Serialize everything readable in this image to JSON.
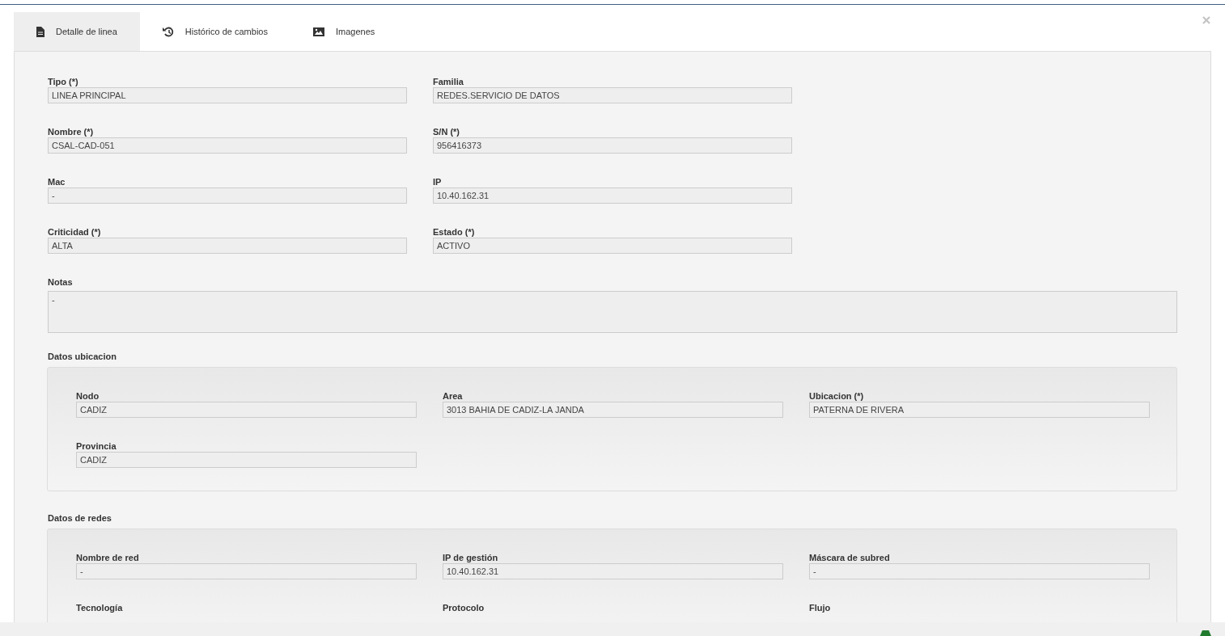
{
  "tabs": [
    {
      "label": "Detalle de linea",
      "selected": true
    },
    {
      "label": "Histórico de cambios",
      "selected": false
    },
    {
      "label": "Imagenes",
      "selected": false
    }
  ],
  "fields": [
    {
      "label": "Tipo (*)",
      "value": "LINEA PRINCIPAL"
    },
    {
      "label": "Familia",
      "value": "REDES.SERVICIO DE DATOS"
    },
    {
      "label": "Nombre (*)",
      "value": "CSAL-CAD-051"
    },
    {
      "label": "S/N (*)",
      "value": "956416373"
    },
    {
      "label": "Mac",
      "value": "-"
    },
    {
      "label": "IP",
      "value": "10.40.162.31"
    },
    {
      "label": "Criticidad (*)",
      "value": "ALTA"
    },
    {
      "label": "Estado (*)",
      "value": "ACTIVO"
    }
  ],
  "notes": {
    "label": "Notas",
    "value": "-"
  },
  "sections": [
    {
      "title": "Datos ubicacion",
      "fields": [
        {
          "label": "Nodo",
          "value": "CADIZ"
        },
        {
          "label": "Area",
          "value": "3013 BAHIA DE CADIZ-LA JANDA"
        },
        {
          "label": "Ubicacion (*)",
          "value": "PATERNA DE RIVERA"
        },
        {
          "label": "Provincia",
          "value": "CADIZ"
        }
      ]
    },
    {
      "title": "Datos de redes",
      "fields": [
        {
          "label": "Nombre de red",
          "value": "-"
        },
        {
          "label": "IP de gestión",
          "value": "10.40.162.31"
        },
        {
          "label": "Máscara de subred",
          "value": "-"
        },
        {
          "label": "Tecnología"
        },
        {
          "label": "Protocolo"
        },
        {
          "label": "Flujo"
        }
      ]
    }
  ]
}
